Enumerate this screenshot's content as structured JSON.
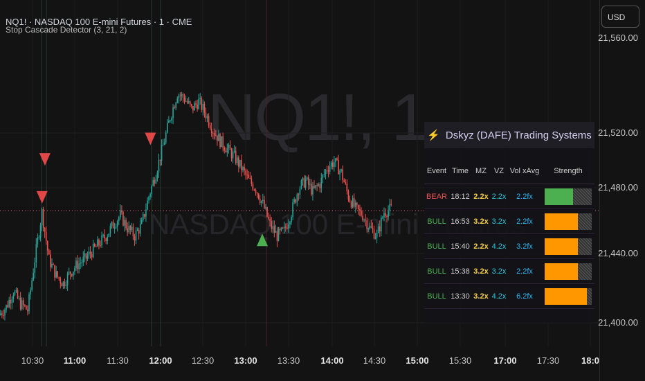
{
  "header": {
    "title": "NQ1! · NASDAQ 100 E-mini Futures · 1 · CME",
    "indicator": "Stop Cascade Detector (3, 21, 2)"
  },
  "watermark": {
    "symbol": "NQ1!, 1",
    "name": "NASDAQ 100 E-mini Futures"
  },
  "currency": "USD",
  "price_axis": [
    "21,560.00",
    "21,520.00",
    "21,480.00",
    "21,440.00",
    "21,400.00"
  ],
  "time_axis": [
    {
      "t": "10:30",
      "bold": false
    },
    {
      "t": "11:00",
      "bold": true
    },
    {
      "t": "11:30",
      "bold": false
    },
    {
      "t": "12:00",
      "bold": true
    },
    {
      "t": "12:30",
      "bold": false
    },
    {
      "t": "13:00",
      "bold": true
    },
    {
      "t": "13:30",
      "bold": false
    },
    {
      "t": "14:00",
      "bold": true
    },
    {
      "t": "14:30",
      "bold": false
    },
    {
      "t": "15:00",
      "bold": true
    },
    {
      "t": "15:30",
      "bold": false
    },
    {
      "t": "17:00",
      "bold": true
    },
    {
      "t": "17:30",
      "bold": false
    },
    {
      "t": "18:0",
      "bold": true
    }
  ],
  "colors": {
    "up": "#26a69a",
    "down": "#ef5350",
    "bear_marker": "#e04848",
    "bull_marker": "#4caf50",
    "price_line": "#e0556a",
    "bull_text": "#4caf50",
    "bear_text": "#ef5350",
    "mz": "#f5d142",
    "vz": "#26c6da",
    "vol": "#29b6f6",
    "strength_green": "#4caf50",
    "strength_orange": "#ff9800"
  },
  "chart_data": {
    "type": "candlestick",
    "interval_min": 5,
    "ylim": [
      21380,
      21565
    ],
    "last_price": 21471,
    "closes": [
      21405,
      21410,
      21420,
      21412,
      21408,
      21440,
      21470,
      21440,
      21430,
      21425,
      21432,
      21437,
      21440,
      21445,
      21450,
      21455,
      21462,
      21468,
      21460,
      21455,
      21462,
      21480,
      21495,
      21512,
      21530,
      21545,
      21542,
      21535,
      21540,
      21532,
      21522,
      21515,
      21510,
      21505,
      21498,
      21490,
      21485,
      21475,
      21462,
      21455,
      21458,
      21470,
      21485,
      21490,
      21483,
      21488,
      21498,
      21502,
      21495,
      21480,
      21472,
      21468,
      21460,
      21455,
      21470,
      21472
    ],
    "markers": [
      {
        "type": "bear",
        "index": 6.3,
        "price": 21502
      },
      {
        "type": "bear",
        "index": 5.9,
        "price": 21478
      },
      {
        "type": "bear",
        "index": 21.1,
        "price": 21515
      },
      {
        "type": "bull",
        "index": 36.8,
        "price": 21452
      }
    ]
  },
  "table": {
    "title": "Dskyz (DAFE) Trading Systems",
    "headers": [
      "Event",
      "Time",
      "MZ",
      "VZ",
      "Vol xAvg",
      "Strength"
    ],
    "rows": [
      {
        "event": "BEAR",
        "time": "18:12",
        "mz": "2.2x",
        "vz": "2.2x",
        "vol": "2.2fx",
        "strength": 0.6,
        "color": "green"
      },
      {
        "event": "BULL",
        "time": "16:53",
        "mz": "3.2x",
        "vz": "3.2x",
        "vol": "2.2fx",
        "strength": 0.7,
        "color": "orange"
      },
      {
        "event": "BULL",
        "time": "15:40",
        "mz": "2.2x",
        "vz": "4.2x",
        "vol": "3.2fx",
        "strength": 0.7,
        "color": "orange"
      },
      {
        "event": "BULL",
        "time": "15:38",
        "mz": "3.2x",
        "vz": "3.2x",
        "vol": "2.2fx",
        "strength": 0.7,
        "color": "orange"
      },
      {
        "event": "BULL",
        "time": "13:30",
        "mz": "3.2x",
        "vz": "4.2x",
        "vol": "6.2fx",
        "strength": 0.9,
        "color": "orange"
      }
    ]
  }
}
